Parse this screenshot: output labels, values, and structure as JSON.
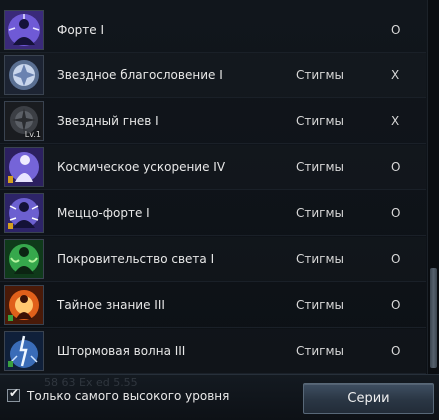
{
  "skills": [
    {
      "name": "Форте I",
      "type": "",
      "status": "O",
      "icon": "forte-icon",
      "level_badge": ""
    },
    {
      "name": "Звездное благословение I",
      "type": "Стигмы",
      "status": "X",
      "icon": "star-blessing-icon",
      "level_badge": ""
    },
    {
      "name": "Звездный гнев I",
      "type": "Стигмы",
      "status": "X",
      "icon": "star-wrath-icon",
      "level_badge": "Lv.1"
    },
    {
      "name": "Космическое ускорение IV",
      "type": "Стигмы",
      "status": "O",
      "icon": "cosmic-acceleration-icon",
      "level_badge": ""
    },
    {
      "name": "Меццо-форте I",
      "type": "Стигмы",
      "status": "O",
      "icon": "mezzo-forte-icon",
      "level_badge": ""
    },
    {
      "name": "Покровительство света I",
      "type": "Стигмы",
      "status": "O",
      "icon": "light-patronage-icon",
      "level_badge": ""
    },
    {
      "name": "Тайное знание III",
      "type": "Стигмы",
      "status": "O",
      "icon": "secret-knowledge-icon",
      "level_badge": ""
    },
    {
      "name": "Штормовая волна III",
      "type": "Стигмы",
      "status": "O",
      "icon": "storm-wave-icon",
      "level_badge": ""
    }
  ],
  "footer": {
    "checkbox_label": "Только самого высокого уровня",
    "checkbox_checked": true,
    "series_button": "Серии",
    "ghost_text": "58   63   Ex ed   5.55"
  },
  "colors": {
    "background": "#0e1217",
    "text": "#e8e8e8",
    "button": "#2a3644"
  }
}
